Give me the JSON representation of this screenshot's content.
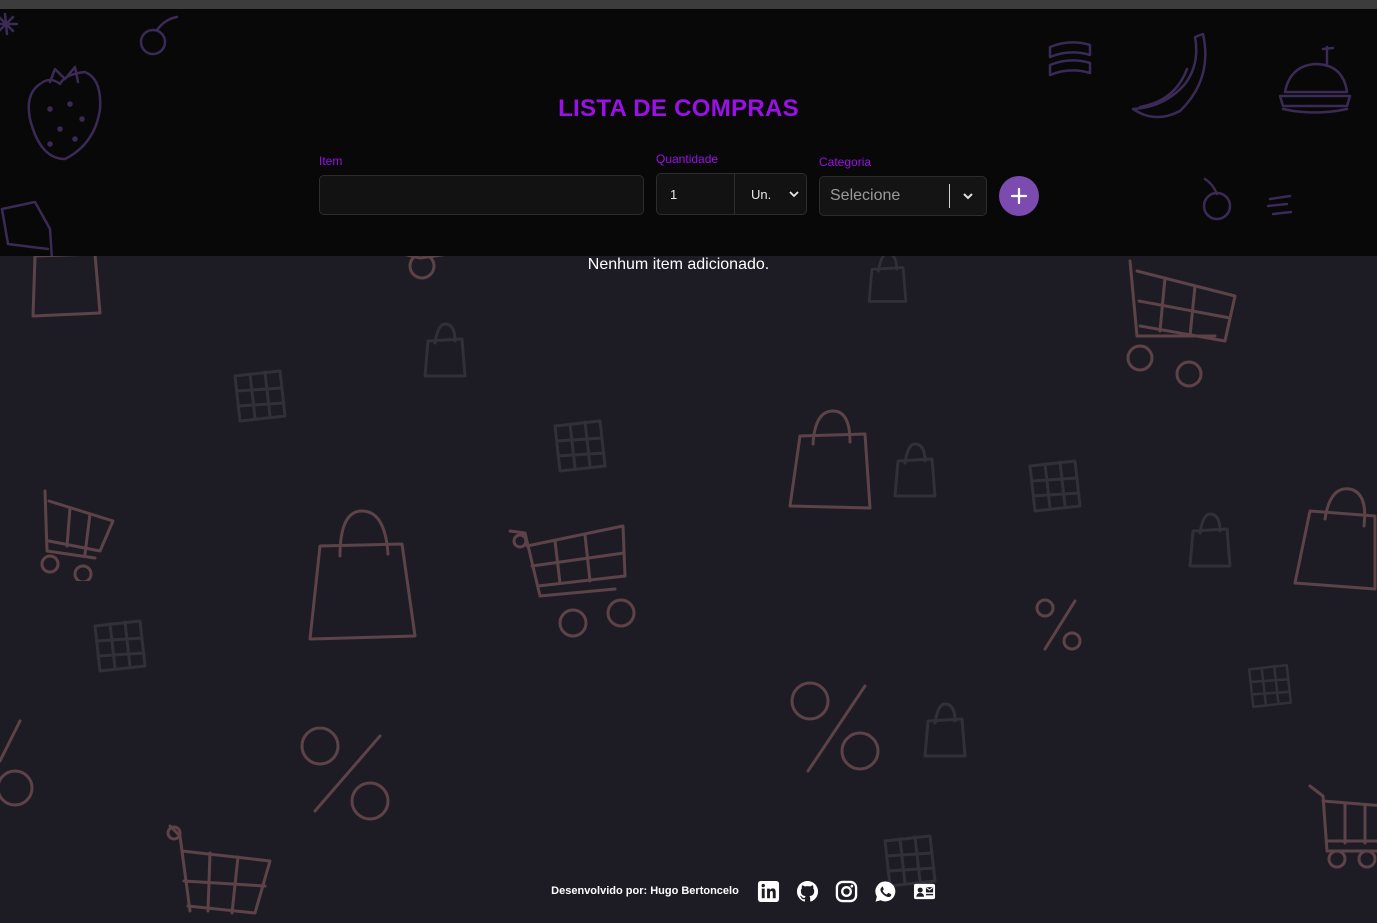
{
  "header": {
    "title": "LISTA DE COMPRAS",
    "item_label": "Item",
    "item_value": "",
    "quantity_label": "Quantidade",
    "quantity_value": "1",
    "unit_value": "Un.",
    "category_label": "Categoria",
    "category_placeholder": "Selecione"
  },
  "list": {
    "empty_message": "Nenhum item adicionado."
  },
  "footer": {
    "credit": "Desenvolvido por: Hugo Bertoncelo",
    "icons": [
      "linkedin-icon",
      "github-icon",
      "instagram-icon",
      "whatsapp-icon",
      "contact-card-icon"
    ]
  },
  "colors": {
    "accent": "#9a10e6",
    "add_button": "#7c4bb0",
    "header_bg": "#080808",
    "page_bg": "#1d1c25"
  }
}
